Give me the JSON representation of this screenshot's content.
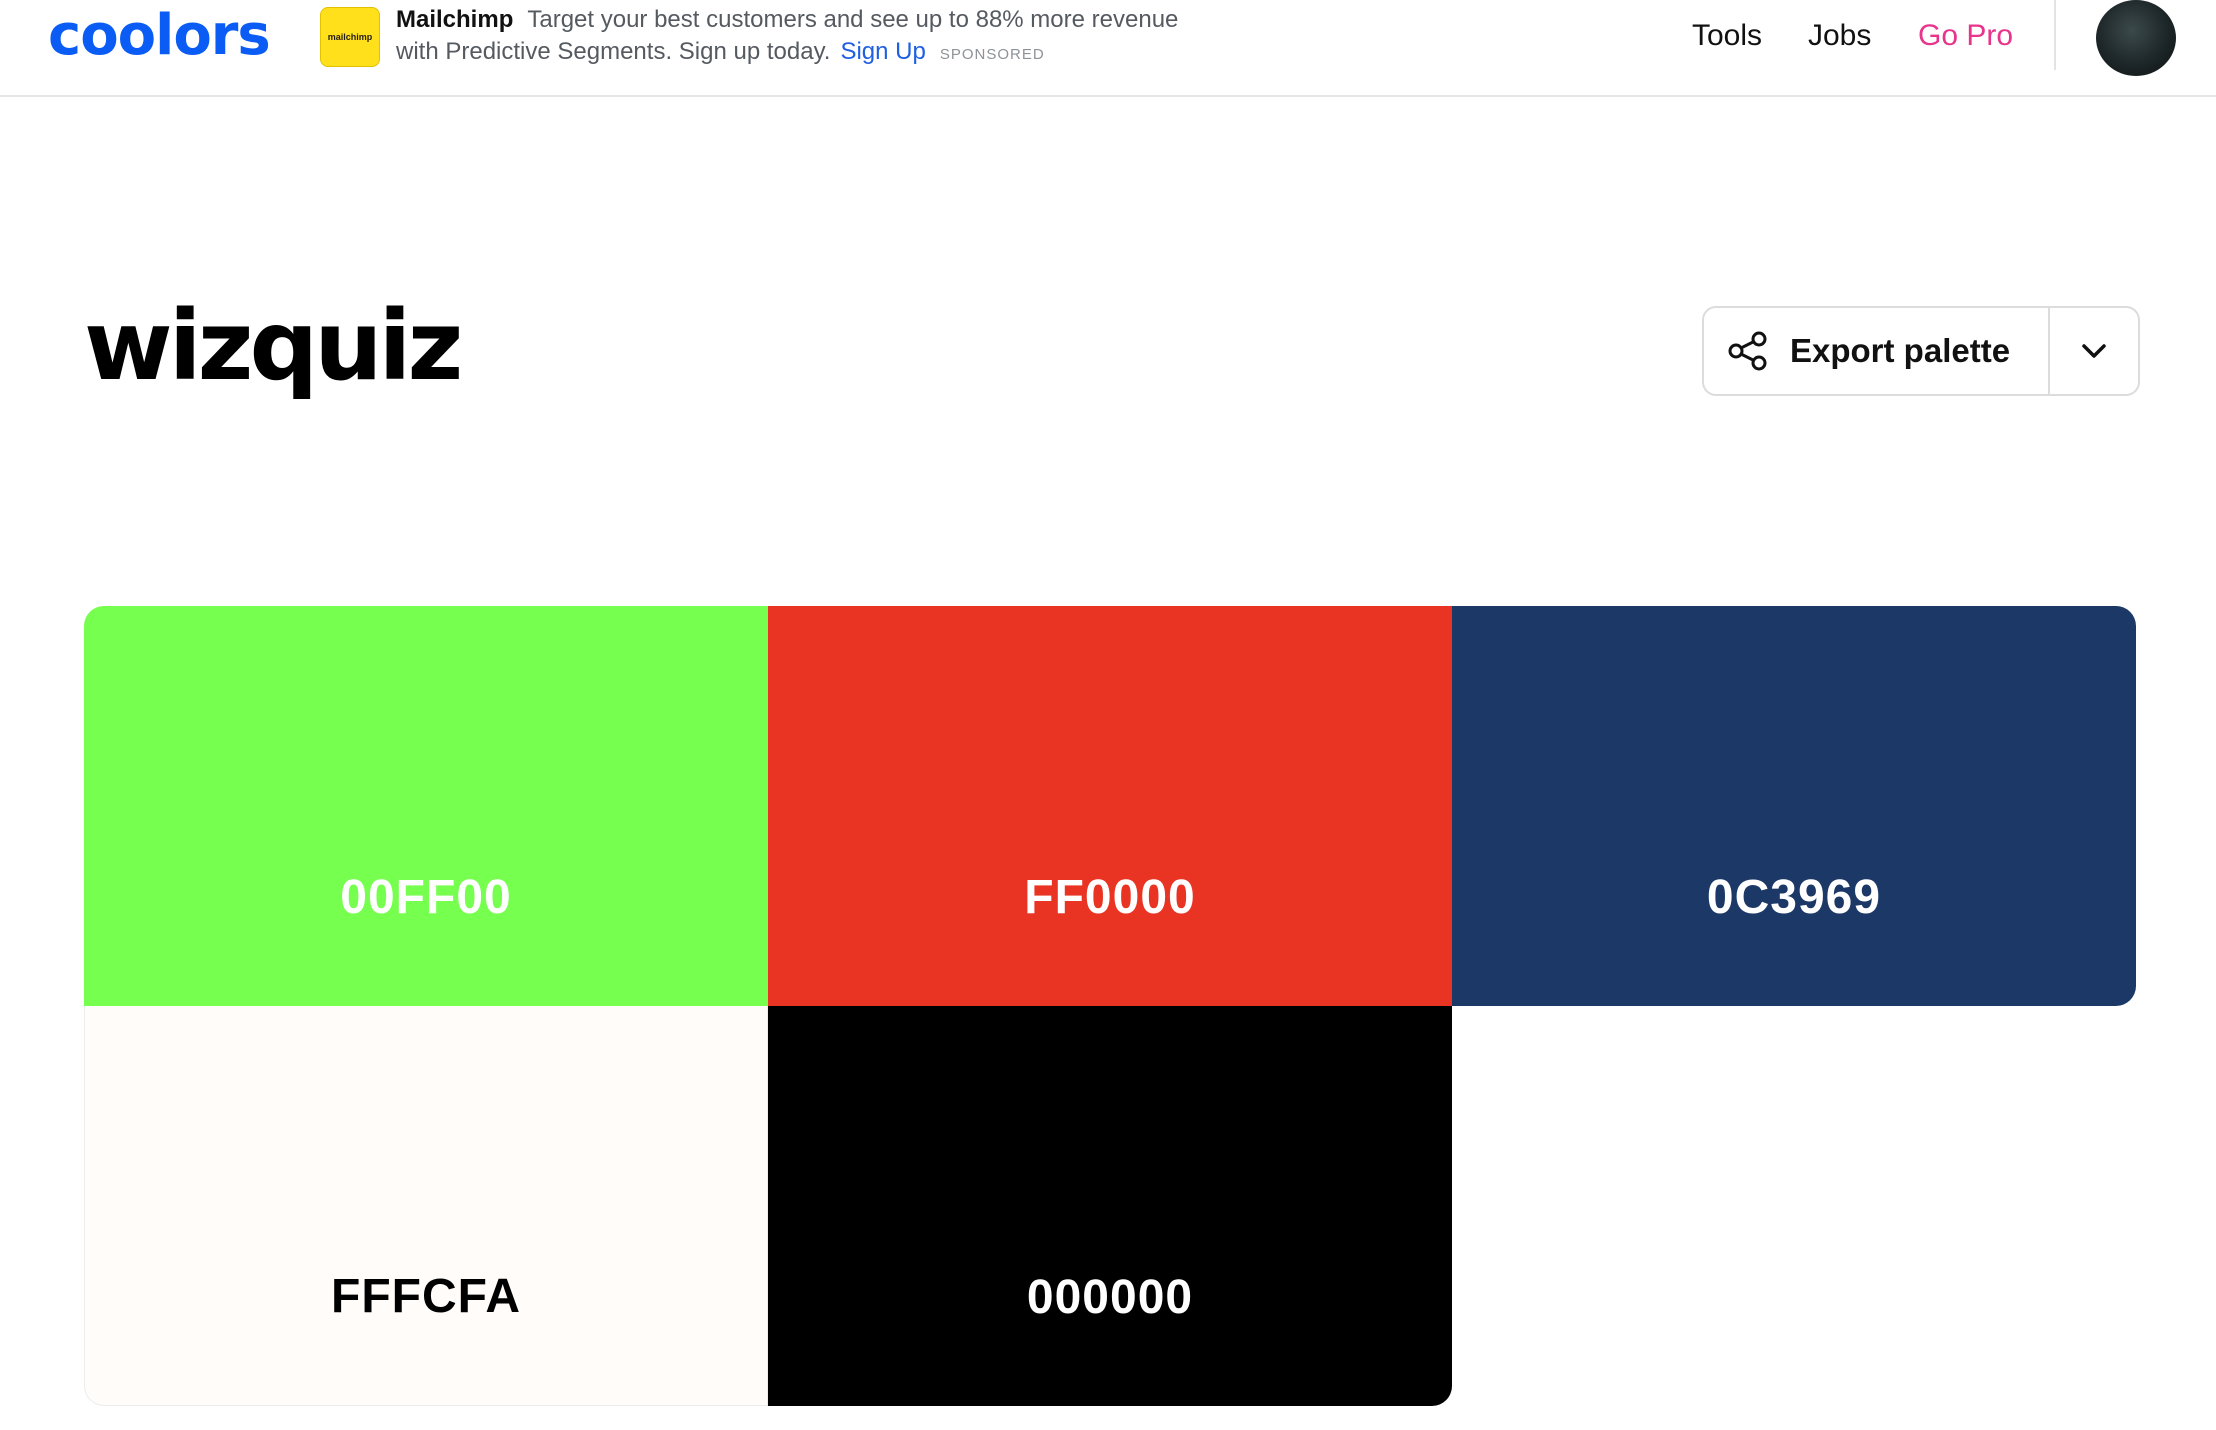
{
  "brand": {
    "logo_text": "coolors",
    "logo_color": "#0a5cf5"
  },
  "ad": {
    "thumb_text": "mailchimp",
    "brand": "Mailchimp",
    "text": "Target your best customers and see up to 88% more revenue with Predictive Segments. Sign up today.",
    "cta": "Sign Up",
    "sponsored": "SPONSORED"
  },
  "nav": {
    "tools": "Tools",
    "jobs": "Jobs",
    "go_pro": "Go Pro",
    "go_pro_color": "#e8348b",
    "avatar_icon": "user-avatar"
  },
  "palette": {
    "title": "wizquiz",
    "export_label": "Export palette",
    "export_icon": "share-icon",
    "dropdown_icon": "chevron-down-icon",
    "swatches": [
      {
        "code": "00FF00",
        "bg": "#76ff4e",
        "text_color": "#ffffff"
      },
      {
        "code": "FF0000",
        "bg": "#e93423",
        "text_color": "#ffffff"
      },
      {
        "code": "0C3969",
        "bg": "#1b3866",
        "text_color": "#ffffff"
      },
      {
        "code": "FFFCFA",
        "bg": "#fffcfa",
        "text_color": "#000000"
      },
      {
        "code": "000000",
        "bg": "#000000",
        "text_color": "#ffffff"
      }
    ]
  }
}
